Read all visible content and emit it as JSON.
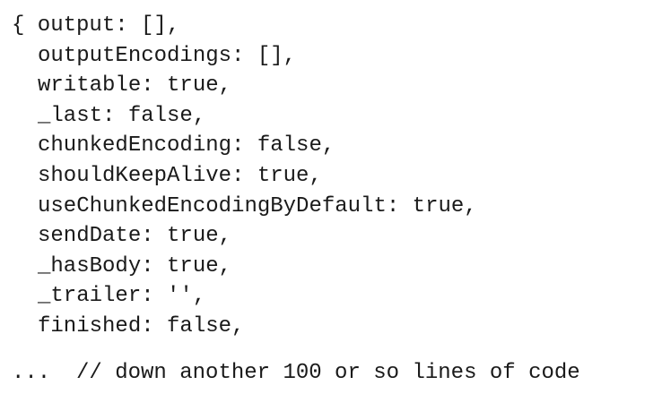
{
  "code": {
    "opening_line": "{ output: [],",
    "properties": [
      "outputEncodings: [],",
      "writable: true,",
      "_last: false,",
      "chunkedEncoding: false,",
      "shouldKeepAlive: true,",
      "useChunkedEncodingByDefault: true,",
      "sendDate: true,",
      "_hasBody: true,",
      "_trailer: '',",
      "finished: false,"
    ],
    "trailing_comment": "...  // down another 100 or so lines of code"
  }
}
